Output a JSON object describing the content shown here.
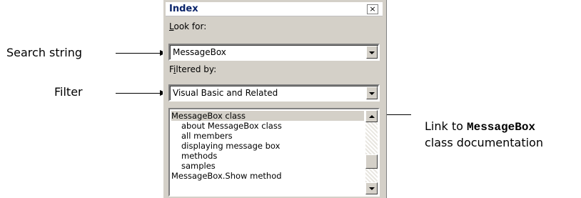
{
  "annotations": {
    "search_string": "Search string",
    "filter": "Filter",
    "link_prefix": "Link to ",
    "link_code": "MessageBox",
    "link_suffix": "class documentation"
  },
  "window": {
    "title": "Index",
    "close_glyph": "×"
  },
  "look_for": {
    "label_underlined": "L",
    "label_rest": "ook for:",
    "value": "MessageBox"
  },
  "filtered_by": {
    "label_prefix": "F",
    "label_underlined": "i",
    "label_rest": "ltered by:",
    "value": "Visual Basic and Related"
  },
  "results": [
    {
      "label": "MessageBox class",
      "selected": true,
      "sub": false
    },
    {
      "label": "about MessageBox class",
      "selected": false,
      "sub": true
    },
    {
      "label": "all members",
      "selected": false,
      "sub": true
    },
    {
      "label": "displaying message box",
      "selected": false,
      "sub": true
    },
    {
      "label": "methods",
      "selected": false,
      "sub": true
    },
    {
      "label": "samples",
      "selected": false,
      "sub": true
    },
    {
      "label": "MessageBox.Show method",
      "selected": false,
      "sub": false
    }
  ]
}
